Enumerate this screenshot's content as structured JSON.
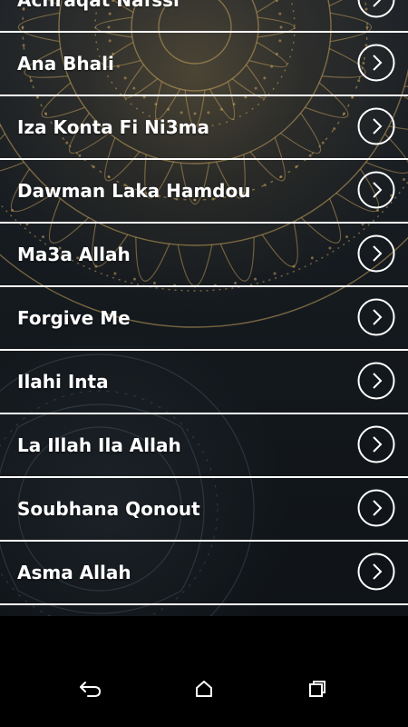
{
  "songs": [
    {
      "title": "Achraqat Nafssi"
    },
    {
      "title": "Ana Bhali"
    },
    {
      "title": "Iza Konta Fi Ni3ma"
    },
    {
      "title": "Dawman Laka Hamdou"
    },
    {
      "title": "Ma3a Allah"
    },
    {
      "title": "Forgive Me"
    },
    {
      "title": "Ilahi Inta"
    },
    {
      "title": "La Illah Ila Allah"
    },
    {
      "title": "Soubhana Qonout"
    },
    {
      "title": "Asma Allah"
    }
  ],
  "icons": {
    "item_arrow": "chevron-right-circle-icon",
    "nav_back": "back-icon",
    "nav_home": "home-icon",
    "nav_recents": "recents-icon"
  },
  "colors": {
    "background": "#151a1f",
    "ornament": "#c9a45c",
    "text": "#ffffff",
    "divider": "#ffffff",
    "navbar": "#000000"
  }
}
